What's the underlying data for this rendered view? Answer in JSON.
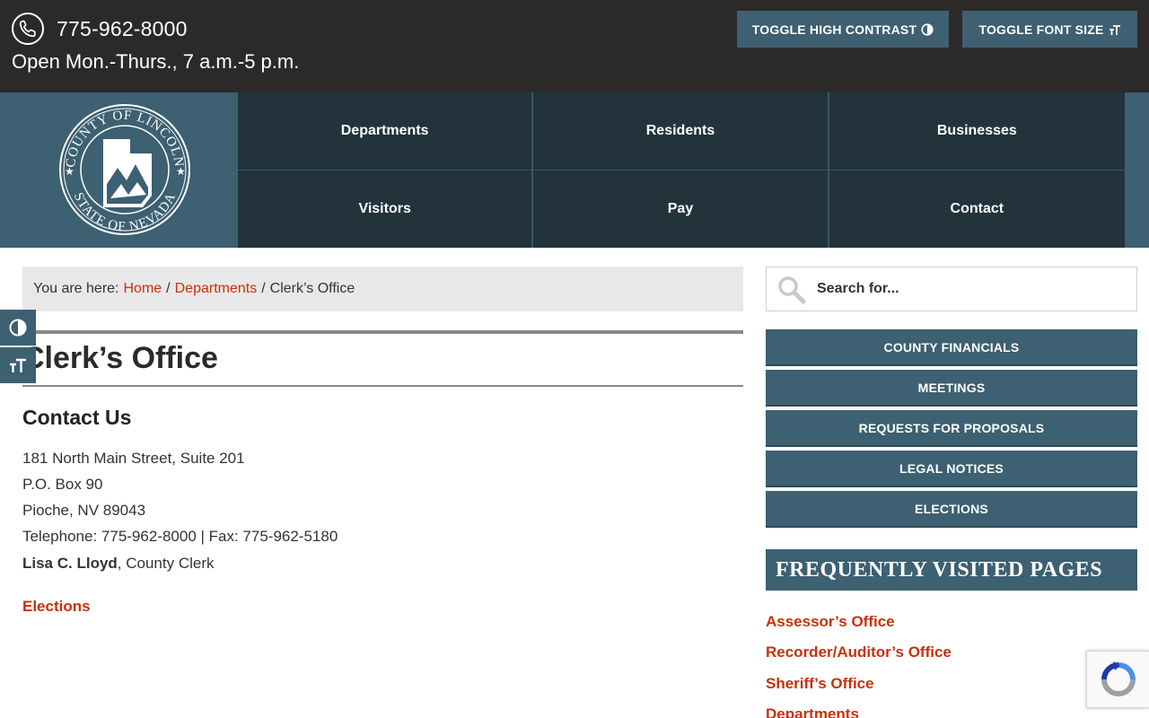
{
  "topbar": {
    "phone": "775-962-8000",
    "hours": "Open Mon.-Thurs., 7 a.m.-5 p.m.",
    "toggle_contrast_label": "TOGGLE HIGH CONTRAST",
    "toggle_font_label": "TOGGLE FONT SIZE",
    "phone_icon": "phone-icon",
    "contrast_icon": "contrast-icon",
    "font_size_icon": "font-size-icon"
  },
  "logo": {
    "top_text": "COUNTY OF LINCOLN",
    "bottom_text": "STATE OF NEVADA"
  },
  "nav": {
    "items": [
      {
        "label": "Departments"
      },
      {
        "label": "Residents"
      },
      {
        "label": "Businesses"
      },
      {
        "label": "Visitors"
      },
      {
        "label": "Pay"
      },
      {
        "label": "Contact"
      }
    ]
  },
  "breadcrumb": {
    "prefix": "You are here:",
    "home": "Home",
    "sep1": "/",
    "departments": "Departments",
    "sep2": "/",
    "current": "Clerk’s Office"
  },
  "main": {
    "title": "Clerk’s Office",
    "contact_heading": "Contact Us",
    "address_line1": "181 North Main Street, Suite 201",
    "address_line2": "P.O. Box 90",
    "address_line3": "Pioche, NV 89043",
    "phone_fax": "Telephone: 775-962-8000 | Fax: 775-962-5180",
    "clerk_name": "Lisa C. Lloyd",
    "clerk_title": ", County Clerk",
    "elections_link": "Elections"
  },
  "sidebar": {
    "search_placeholder": "Search for...",
    "buttons": [
      {
        "label": "COUNTY FINANCIALS"
      },
      {
        "label": "MEETINGS"
      },
      {
        "label": "REQUESTS FOR PROPOSALS"
      },
      {
        "label": "LEGAL NOTICES"
      },
      {
        "label": "ELECTIONS"
      }
    ],
    "fvp_heading": "FREQUENTLY VISITED PAGES",
    "fvp_links": [
      {
        "label": "Assessor’s Office"
      },
      {
        "label": "Recorder/Auditor’s Office"
      },
      {
        "label": "Sheriff’s Office"
      },
      {
        "label": "Departments"
      }
    ]
  },
  "colors": {
    "topbar_bg": "#2b2a29",
    "brand_teal": "#3d6072",
    "nav_bg": "#22333c",
    "link_red": "#c7310c"
  }
}
